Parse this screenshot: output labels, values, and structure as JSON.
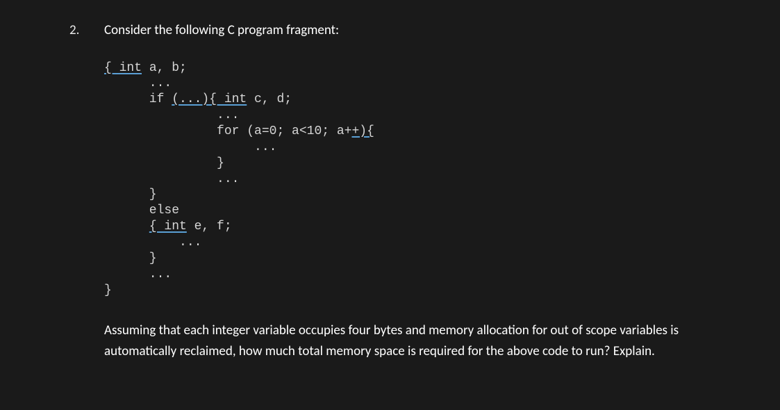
{
  "question": {
    "number": "2.",
    "intro": "Consider the following C program fragment:",
    "code": {
      "l1_a": "{ int",
      "l1_b": " a, b;",
      "l2": "      ...",
      "l3_a": "      if ",
      "l3_b": "(...){ int",
      "l3_c": " c, d;",
      "l4": "               ...",
      "l5_a": "               for (a=0; a<10; a+",
      "l5_b": "+){",
      "l6": "                    ...",
      "l7": "               }",
      "l8": "               ...",
      "l9": "      }",
      "l10": "      else",
      "l11_a": "      ",
      "l11_b": "{ int",
      "l11_c": " e, f;",
      "l12": "          ...",
      "l13": "      }",
      "l14": "      ...",
      "l15": "}"
    },
    "followup": "Assuming that each integer variable occupies four bytes and memory allocation for out of scope variables is automatically reclaimed, how much total memory space is required for the above code to run? Explain."
  }
}
